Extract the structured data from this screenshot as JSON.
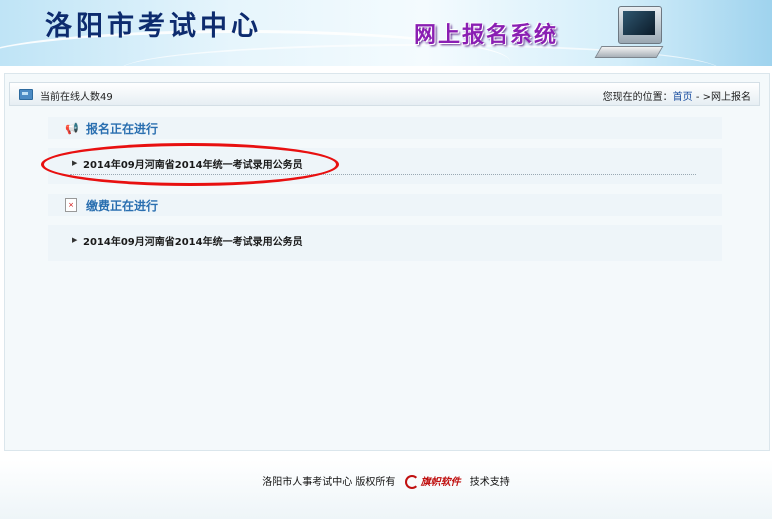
{
  "header": {
    "site_title": "洛阳市考试中心",
    "system_title": "网上报名系统"
  },
  "statusbar": {
    "online_text": "当前在线人数49",
    "location_prefix": "您现在的位置：",
    "home_link": "首页",
    "separator": " - >",
    "current_page": "网上报名"
  },
  "sections": [
    {
      "heading": "报名正在进行",
      "icon": "megaphone-icon",
      "items": [
        "2014年09月河南省2014年统一考试录用公务员"
      ]
    },
    {
      "heading": "缴费正在进行",
      "icon": "document-x-icon",
      "items": [
        "2014年09月河南省2014年统一考试录用公务员"
      ]
    }
  ],
  "footer": {
    "copyright": "洛阳市人事考试中心  版权所有",
    "vendor_logo": "旗帜软件",
    "support": "技术支持"
  },
  "colors": {
    "heading_blue": "#2a6fb0",
    "highlight_red": "#e81010",
    "title_navy": "#0d2b6e",
    "system_title_purple": "#8a1fb3"
  }
}
